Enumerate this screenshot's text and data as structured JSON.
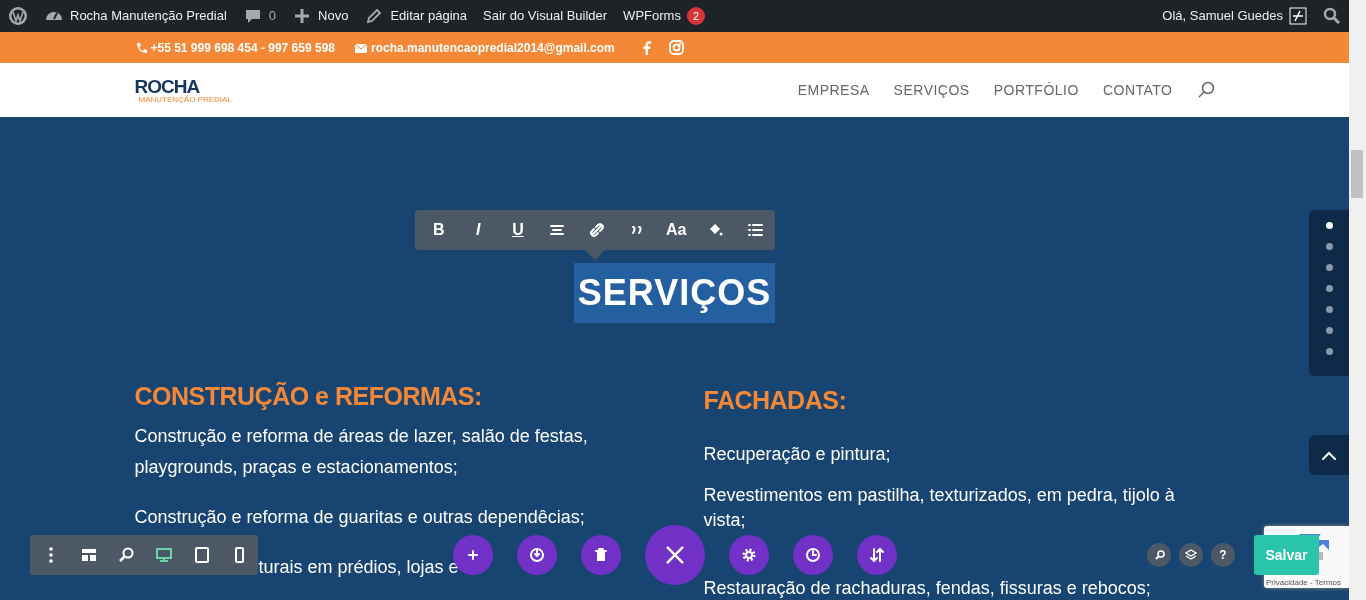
{
  "admin_bar": {
    "items": [
      {
        "kind": "site",
        "label": "Rocha Manutenção Predial"
      },
      {
        "kind": "comments",
        "label": "0"
      },
      {
        "kind": "new",
        "label": "Novo"
      },
      {
        "kind": "edit",
        "label": "Editar página"
      },
      {
        "kind": "plain",
        "label": "Sair do Visual Builder"
      },
      {
        "kind": "badge",
        "label": "WPForms",
        "badge": "2"
      }
    ],
    "user": "Olá, Samuel Guedes"
  },
  "top_bar": {
    "phone": "+55 51 999 698 454 - 997 659 598",
    "email": "rocha.manutencaopredial2014@gmail.com"
  },
  "header": {
    "logo": "ROCHA",
    "logo_tagline": "MANUTENÇÃO PREDIAL",
    "nav": [
      "EMPRESA",
      "SERVIÇOS",
      "PORTFÓLIO",
      "CONTATO"
    ]
  },
  "section": {
    "title": "SERVIÇOS",
    "title_selected": true,
    "columns": [
      {
        "heading": "CONSTRUÇÃO e REFORMAS:",
        "paragraphs": [
          "Construção e reforma de áreas de lazer, salão de festas, playgrounds, praças e estacionamentos;",
          "Construção e reforma de guaritas e outras dependêcias;",
          "turais em prédios, lojas e"
        ]
      },
      {
        "heading": "FACHADAS:",
        "paragraphs": [
          "Recuperação e pintura;",
          "Revestimentos em pastilha, texturizados, em pedra, tijolo à vista;",
          "Restauração de rachaduras, fendas, fissuras e rebocos;"
        ]
      }
    ]
  },
  "text_toolbar": [
    {
      "kind": "bold",
      "label": "B"
    },
    {
      "kind": "italic",
      "label": "I"
    },
    {
      "kind": "underline",
      "label": "U"
    },
    {
      "kind": "align"
    },
    {
      "kind": "link"
    },
    {
      "kind": "quote"
    },
    {
      "kind": "font",
      "label": "Aa"
    },
    {
      "kind": "color"
    },
    {
      "kind": "list"
    }
  ],
  "dot_nav": [
    {
      "selected": true
    },
    {
      "selected": false
    },
    {
      "selected": false
    },
    {
      "selected": false
    },
    {
      "selected": false
    },
    {
      "selected": false
    },
    {
      "selected": false
    }
  ],
  "view_bar": [
    {
      "kind": "menu",
      "selected": false
    },
    {
      "kind": "wireframe",
      "selected": false
    },
    {
      "kind": "zoom",
      "selected": false
    },
    {
      "kind": "desktop",
      "selected": true
    },
    {
      "kind": "tablet",
      "selected": false
    },
    {
      "kind": "phone",
      "selected": false
    }
  ],
  "actions": [
    {
      "kind": "add"
    },
    {
      "kind": "portability"
    },
    {
      "kind": "trash"
    },
    {
      "kind": "close"
    },
    {
      "kind": "settings"
    },
    {
      "kind": "history"
    },
    {
      "kind": "sort"
    }
  ],
  "tools": [
    {
      "kind": "search"
    },
    {
      "kind": "layers"
    },
    {
      "kind": "help",
      "label": "?"
    }
  ],
  "save_button": "Salvar",
  "recaptcha": "Privacidade - Termos"
}
